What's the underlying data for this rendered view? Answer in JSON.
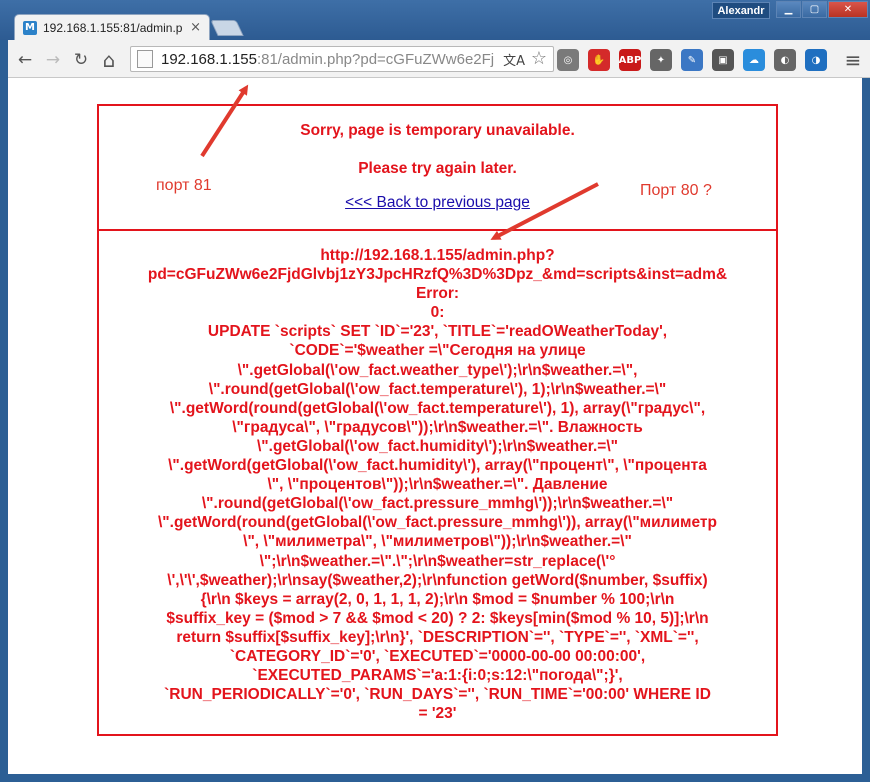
{
  "window": {
    "user": "Alexandr",
    "minimize_glyph": "▁",
    "maximize_glyph": "▢",
    "close_glyph": "✕"
  },
  "tab": {
    "title": "192.168.1.155:81/admin.p",
    "favicon_letter": "M",
    "close_glyph": "×"
  },
  "toolbar": {
    "back_icon": "←",
    "forward_icon": "→",
    "reload_icon": "↻",
    "home_icon": "⌂",
    "menu_icon": "≡"
  },
  "address": {
    "host": "192.168.1.155",
    "rest": ":81/admin.php?pd=cGFuZWw6e2Fj",
    "translate_icon": "文A",
    "star_icon": "☆"
  },
  "extensions": [
    {
      "name": "sync-extension-icon",
      "glyph": "◎",
      "color": "#7a7a7a"
    },
    {
      "name": "stop-extension-icon",
      "glyph": "✋",
      "color": "#d42a2a"
    },
    {
      "name": "abp-extension-icon",
      "glyph": "ABP",
      "color": "#c91a1a"
    },
    {
      "name": "satellite-extension-icon",
      "glyph": "✦",
      "color": "#666666"
    },
    {
      "name": "pen-extension-icon",
      "glyph": "✎",
      "color": "#3b77c4"
    },
    {
      "name": "camera-extension-icon",
      "glyph": "▣",
      "color": "#555555"
    },
    {
      "name": "cloud-extension-icon",
      "glyph": "☁",
      "color": "#2a8ddc"
    },
    {
      "name": "cup-extension-icon",
      "glyph": "◐",
      "color": "#666666"
    },
    {
      "name": "globe-extension-icon",
      "glyph": "◑",
      "color": "#1f6fc0"
    }
  ],
  "page": {
    "sorry": "Sorry, page is temporary unavailable.",
    "try_again": "Please try again later.",
    "back_link": "<<< Back to previous page",
    "error_lines": [
      "http://192.168.1.155/admin.php?",
      "pd=cGFuZWw6e2FjdGlvbj1zY3JpcHRzfQ%3D%3Dpz_&md=scripts&inst=adm&",
      "Error:",
      "0:",
      "UPDATE `scripts` SET `ID`='23', `TITLE`='readOWeatherToday',",
      "`CODE`='$weather =\\\"Сегодня на улице",
      "\\\".getGlobal(\\'ow_fact.weather_type\\');\\r\\n$weather.=\\\",",
      "\\\".round(getGlobal(\\'ow_fact.temperature\\'), 1);\\r\\n$weather.=\\\"",
      "\\\".getWord(round(getGlobal(\\'ow_fact.temperature\\'), 1), array(\\\"градус\\\",",
      "\\\"градуса\\\", \\\"градусов\\\"));\\r\\n$weather.=\\\". Влажность",
      "\\\".getGlobal(\\'ow_fact.humidity\\');\\r\\n$weather.=\\\"",
      "\\\".getWord(getGlobal(\\'ow_fact.humidity\\'), array(\\\"процент\\\", \\\"процента",
      "\\\", \\\"процентов\\\"));\\r\\n$weather.=\\\". Давление",
      "\\\".round(getGlobal(\\'ow_fact.pressure_mmhg\\'));\\r\\n$weather.=\\\"",
      "\\\".getWord(round(getGlobal(\\'ow_fact.pressure_mmhg\\')), array(\\\"милиметр",
      "\\\", \\\"милиметра\\\", \\\"милиметров\\\"));\\r\\n$weather.=\\\"",
      "\\\";\\r\\n$weather.=\\\".\\\";\\r\\n$weather=str_replace(\\'°",
      "\\',\\'\\',$weather);\\r\\nsay($weather,2);\\r\\nfunction getWord($number, $suffix)",
      "{\\r\\n $keys = array(2, 0, 1, 1, 1, 2);\\r\\n $mod = $number % 100;\\r\\n",
      "$suffix_key = ($mod > 7 && $mod < 20) ? 2: $keys[min($mod % 10, 5)];\\r\\n",
      "return $suffix[$suffix_key];\\r\\n}', `DESCRIPTION`='', `TYPE`='', `XML`='',",
      "`CATEGORY_ID`='0', `EXECUTED`='0000-00-00 00:00:00',",
      "`EXECUTED_PARAMS`='a:1:{i:0;s:12:\\\"погода\\\";}',",
      "`RUN_PERIODICALLY`='0', `RUN_DAYS`='', `RUN_TIME`='00:00' WHERE ID",
      "= '23'"
    ]
  },
  "annotations": {
    "port81": "порт 81",
    "port80": "Порт 80 ?",
    "color": "#e03a2e"
  }
}
